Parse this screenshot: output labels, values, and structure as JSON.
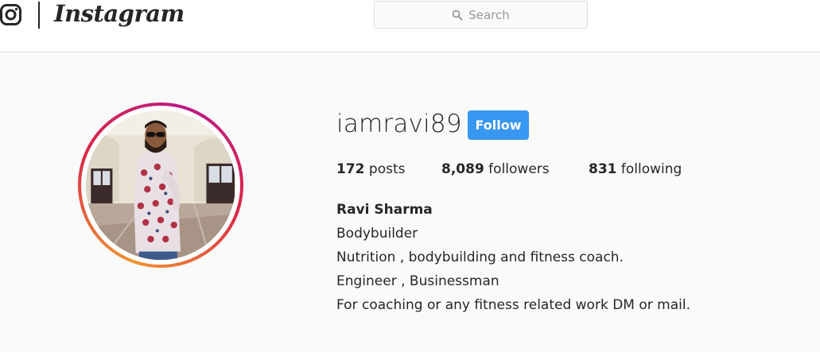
{
  "header": {
    "brand": "Instagram",
    "search_placeholder": "Search",
    "icons": {
      "logo": "instagram-glyph-icon",
      "search": "search-icon"
    }
  },
  "profile": {
    "username": "iamravi89",
    "follow_label": "Follow",
    "stats": {
      "posts_count": "172",
      "posts_label": " posts",
      "followers_count": "8,089",
      "followers_label": " followers",
      "following_count": "831",
      "following_label": " following"
    },
    "full_name": "Ravi Sharma",
    "bio_lines": [
      "Bodybuilder",
      "Nutrition , bodybuilding and fitness coach.",
      "Engineer , Businessman",
      "For coaching or any fitness related work DM or mail."
    ]
  },
  "colors": {
    "follow_button": "#3897f0",
    "background": "#fafafa",
    "text": "#262626"
  }
}
